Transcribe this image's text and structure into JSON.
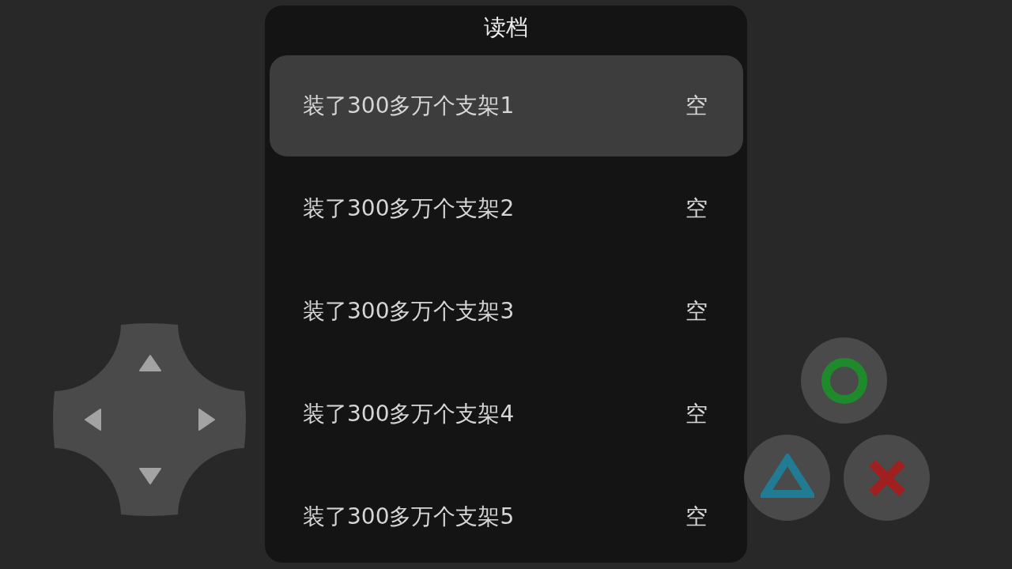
{
  "dialog": {
    "title": "读档"
  },
  "slots": [
    {
      "name": "装了300多万个支架1",
      "status": "空",
      "selected": true
    },
    {
      "name": "装了300多万个支架2",
      "status": "空",
      "selected": false
    },
    {
      "name": "装了300多万个支架3",
      "status": "空",
      "selected": false
    },
    {
      "name": "装了300多万个支架4",
      "status": "空",
      "selected": false
    },
    {
      "name": "装了300多万个支架5",
      "status": "空",
      "selected": false
    }
  ]
}
